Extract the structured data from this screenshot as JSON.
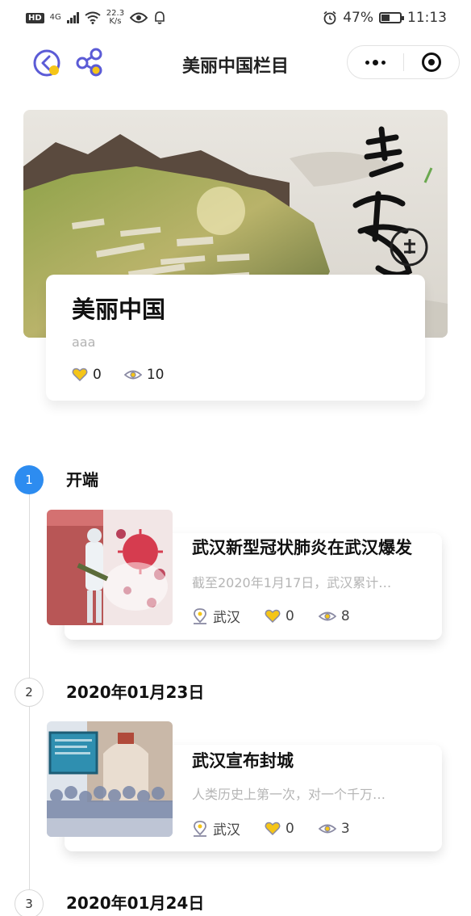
{
  "status_bar": {
    "hd": "HD",
    "network": "4G",
    "speed_value": "22.3",
    "speed_unit": "K/s",
    "battery_percent": "47%",
    "battery_level": 0.47,
    "time": "11:13",
    "icons": [
      "signal-icon",
      "wifi-icon",
      "eye-icon",
      "bell-icon",
      "alarm-icon",
      "battery-icon"
    ]
  },
  "nav": {
    "title": "美丽中国栏目",
    "icons": [
      "back-icon",
      "share-icon",
      "more-icon",
      "close-miniapp-icon"
    ]
  },
  "hero": {
    "image": "landscape-banner",
    "title": "美丽中国",
    "description": "aaa",
    "likes": "0",
    "views": "10"
  },
  "timeline": [
    {
      "number": "1",
      "label": "开端",
      "active": true,
      "event": {
        "image": "disinfection-illustration",
        "title": "武汉新型冠状肺炎在武汉爆发",
        "description": "截至2020年1月17日，武汉累计…",
        "location": "武汉",
        "likes": "0",
        "views": "8"
      }
    },
    {
      "number": "2",
      "label": "2020年01月23日",
      "active": false,
      "event": {
        "image": "hankou-station-crowd",
        "title": "武汉宣布封城",
        "description": "人类历史上第一次，对一个千万…",
        "location": "武汉",
        "likes": "0",
        "views": "3"
      }
    },
    {
      "number": "3",
      "label": "2020年01月24日",
      "active": false
    }
  ],
  "colors": {
    "accent": "#2d8cf0",
    "like": "#f5c518",
    "nav_icon": "#5b5bd6"
  }
}
